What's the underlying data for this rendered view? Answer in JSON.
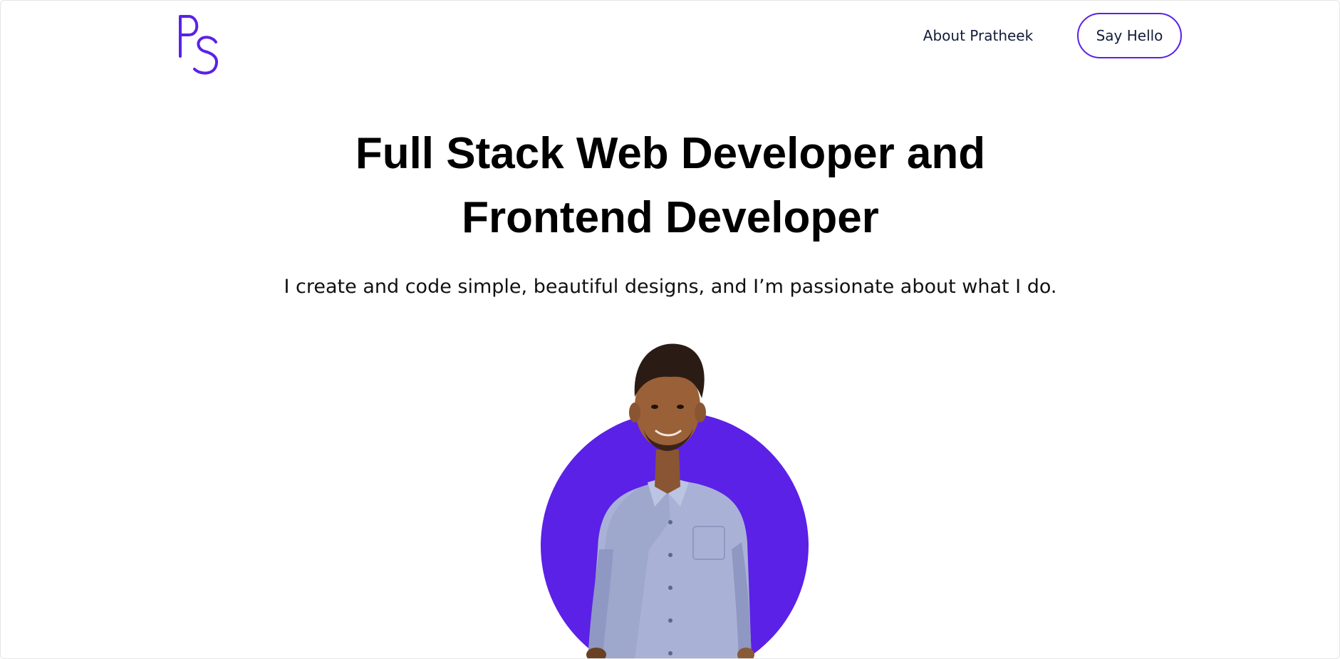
{
  "header": {
    "logo_text": "PS",
    "logo_color": "#5b21e6",
    "nav_about_label": "About Pratheek",
    "say_hello_label": "Say Hello"
  },
  "hero": {
    "title_line1": "Full Stack Web Developer and",
    "title_line2": "Frontend Developer",
    "subtitle": "I create and code simple, beautiful designs, and I’m passionate about what I do."
  },
  "avatar": {
    "icon": "person-photo",
    "circle_color": "#5b21e6"
  }
}
